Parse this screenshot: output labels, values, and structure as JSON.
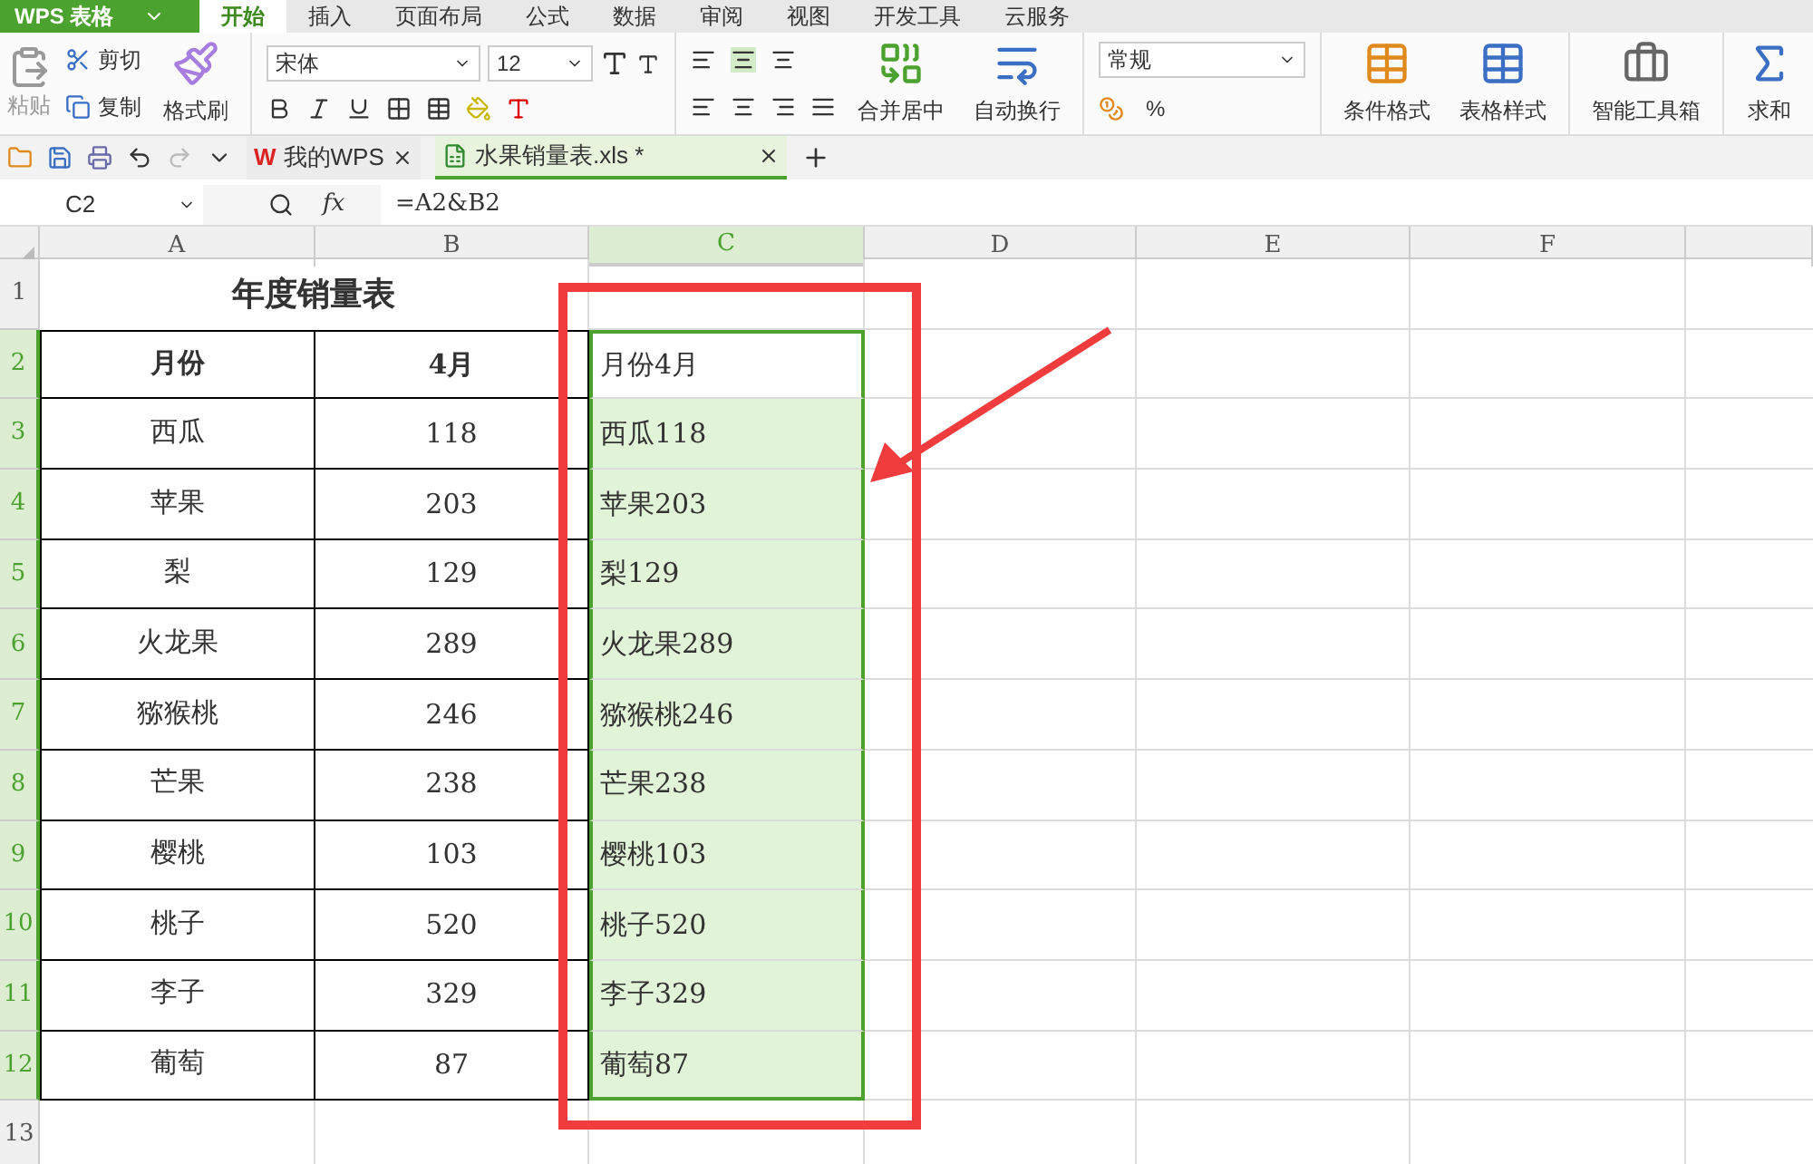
{
  "app_button": "WPS 表格",
  "menu_tabs": [
    {
      "label": "开始",
      "selected": true
    },
    {
      "label": "插入",
      "selected": false
    },
    {
      "label": "页面布局",
      "selected": false
    },
    {
      "label": "公式",
      "selected": false
    },
    {
      "label": "数据",
      "selected": false
    },
    {
      "label": "审阅",
      "selected": false
    },
    {
      "label": "视图",
      "selected": false
    },
    {
      "label": "开发工具",
      "selected": false
    },
    {
      "label": "云服务",
      "selected": false
    }
  ],
  "ribbon": {
    "paste": "粘贴",
    "cut": "剪切",
    "copy": "复制",
    "format_painter": "格式刷",
    "font_name": "宋体",
    "font_size": "12",
    "merge": "合并居中",
    "wrap": "自动换行",
    "number_format": "常规",
    "percent": "%",
    "conditional_format": "条件格式",
    "table_style": "表格样式",
    "toolbox": "智能工具箱",
    "sum": "求和"
  },
  "doc_tabs": [
    {
      "label": "我的WPS",
      "selected": false,
      "kind": "home",
      "logo": "W"
    },
    {
      "label": "水果销量表.xls *",
      "selected": true,
      "kind": "sheet"
    }
  ],
  "name_box": "C2",
  "fx": "fx",
  "formula": "=A2&B2",
  "columns": [
    {
      "label": "A",
      "selected": false
    },
    {
      "label": "B",
      "selected": false
    },
    {
      "label": "C",
      "selected": true
    },
    {
      "label": "D",
      "selected": false
    },
    {
      "label": "E",
      "selected": false
    },
    {
      "label": "F",
      "selected": false
    }
  ],
  "rows": [
    {
      "label": "1",
      "kind": "title",
      "selected": false,
      "cells": [
        "年度销量表"
      ]
    },
    {
      "label": "2",
      "kind": "header",
      "selected": true,
      "active": true,
      "cells": [
        "月份",
        "4月",
        "月份4月"
      ]
    },
    {
      "label": "3",
      "kind": "data",
      "selected": true,
      "active": false,
      "cells": [
        "西瓜",
        "118",
        "西瓜118"
      ]
    },
    {
      "label": "4",
      "kind": "data",
      "selected": true,
      "active": false,
      "cells": [
        "苹果",
        "203",
        "苹果203"
      ]
    },
    {
      "label": "5",
      "kind": "data",
      "selected": true,
      "active": false,
      "cells": [
        "梨",
        "129",
        "梨129"
      ]
    },
    {
      "label": "6",
      "kind": "data",
      "selected": true,
      "active": false,
      "cells": [
        "火龙果",
        "289",
        "火龙果289"
      ]
    },
    {
      "label": "7",
      "kind": "data",
      "selected": true,
      "active": false,
      "cells": [
        "猕猴桃",
        "246",
        "猕猴桃246"
      ]
    },
    {
      "label": "8",
      "kind": "data",
      "selected": true,
      "active": false,
      "cells": [
        "芒果",
        "238",
        "芒果238"
      ]
    },
    {
      "label": "9",
      "kind": "data",
      "selected": true,
      "active": false,
      "cells": [
        "樱桃",
        "103",
        "樱桃103"
      ]
    },
    {
      "label": "10",
      "kind": "data",
      "selected": true,
      "active": false,
      "cells": [
        "桃子",
        "520",
        "桃子520"
      ]
    },
    {
      "label": "11",
      "kind": "data",
      "selected": true,
      "active": false,
      "cells": [
        "李子",
        "329",
        "李子329"
      ]
    },
    {
      "label": "12",
      "kind": "data",
      "selected": true,
      "active": false,
      "cells": [
        "葡萄",
        "87",
        "葡萄87"
      ]
    },
    {
      "label": "13",
      "kind": "empty",
      "selected": false,
      "cells": []
    }
  ],
  "annotation": {
    "highlight_box": true,
    "arrow": true
  }
}
